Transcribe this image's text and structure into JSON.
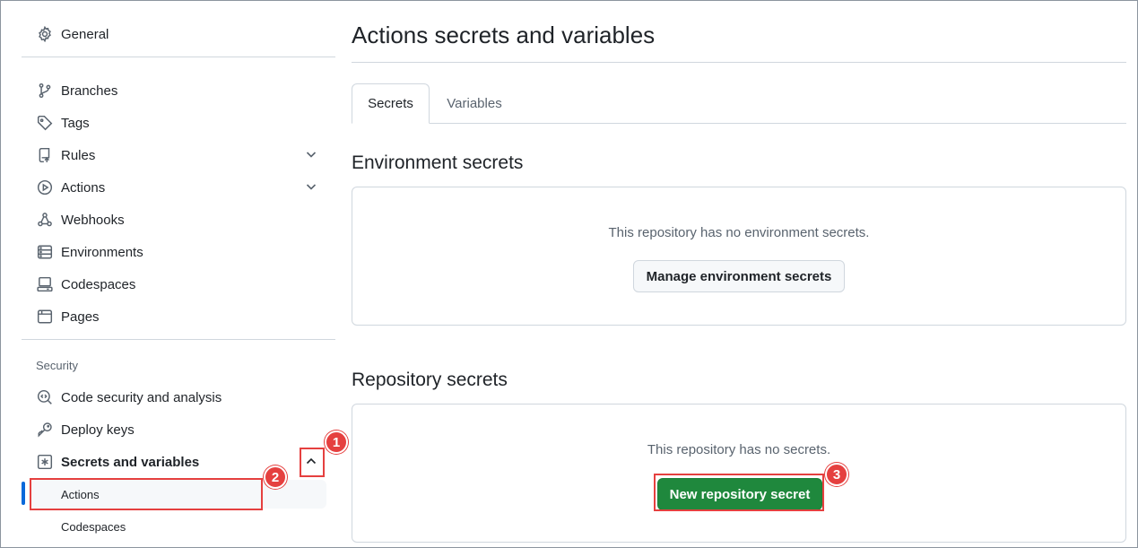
{
  "sidebar": {
    "general": "General",
    "items": [
      {
        "label": "Branches",
        "icon": "git-branch-icon"
      },
      {
        "label": "Tags",
        "icon": "tag-icon"
      },
      {
        "label": "Rules",
        "icon": "repo-push-icon"
      },
      {
        "label": "Actions",
        "icon": "play-icon"
      },
      {
        "label": "Webhooks",
        "icon": "webhook-icon"
      },
      {
        "label": "Environments",
        "icon": "server-icon"
      },
      {
        "label": "Codespaces",
        "icon": "codespaces-icon"
      },
      {
        "label": "Pages",
        "icon": "browser-icon"
      }
    ],
    "security_heading": "Security",
    "security_items": [
      {
        "label": "Code security and analysis",
        "icon": "codescan-icon"
      },
      {
        "label": "Deploy keys",
        "icon": "key-icon"
      },
      {
        "label": "Secrets and variables",
        "icon": "asterisk-icon"
      }
    ],
    "sub_items": [
      {
        "label": "Actions",
        "active": true
      },
      {
        "label": "Codespaces",
        "active": false
      }
    ]
  },
  "main": {
    "title": "Actions secrets and variables",
    "tabs": [
      {
        "label": "Secrets",
        "selected": true
      },
      {
        "label": "Variables",
        "selected": false
      }
    ],
    "environment": {
      "heading": "Environment secrets",
      "empty_text": "This repository has no environment secrets.",
      "button_label": "Manage environment secrets"
    },
    "repository": {
      "heading": "Repository secrets",
      "empty_text": "This repository has no secrets.",
      "button_label": "New repository secret"
    }
  },
  "annotations": {
    "markers": [
      "1",
      "2",
      "3"
    ],
    "color": "#e5403f"
  },
  "colors": {
    "accent": "#0969da",
    "primary_button": "#1f883d"
  }
}
